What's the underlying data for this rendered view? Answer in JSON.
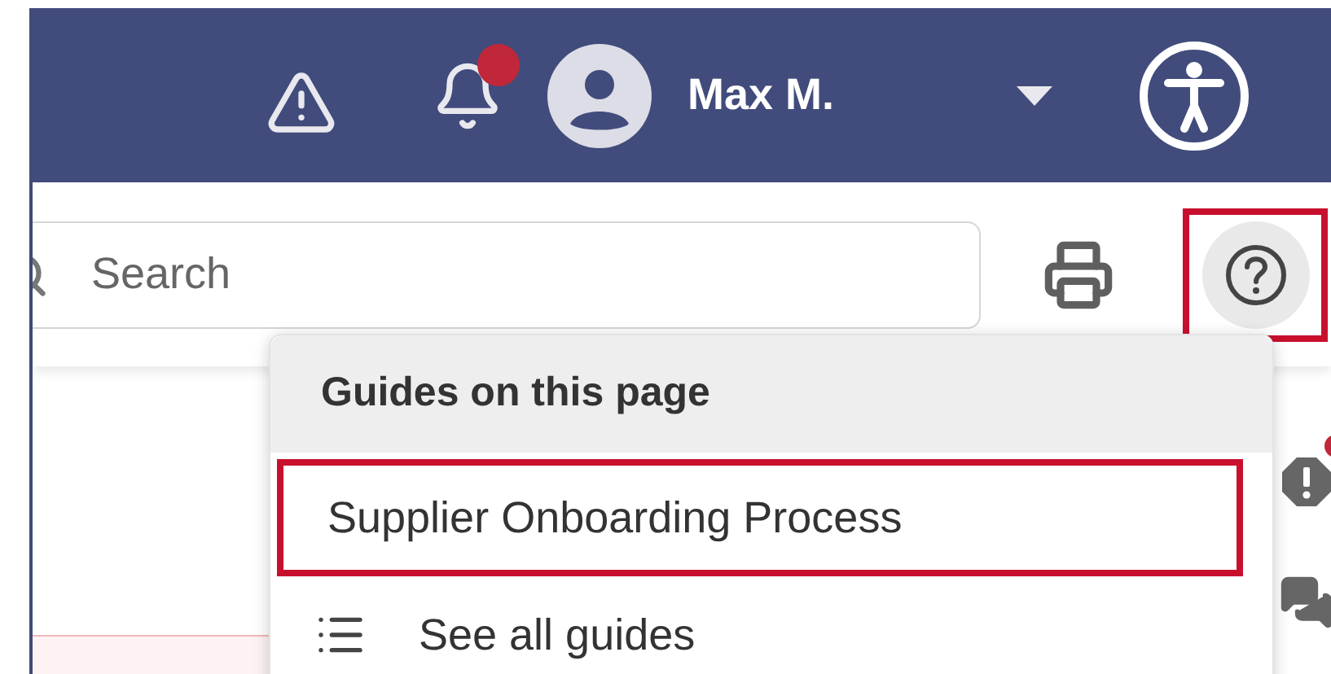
{
  "header": {
    "user_name": "Max M.",
    "notifications_unread": true
  },
  "toolbar": {
    "search": {
      "placeholder": "Search"
    },
    "help_button": {
      "highlighted": true
    }
  },
  "guides_menu": {
    "title": "Guides on this page",
    "items": [
      {
        "kind": "guide",
        "label": "Supplier Onboarding Process",
        "highlighted": true
      },
      {
        "kind": "all",
        "label": "See all guides",
        "highlighted": false
      }
    ]
  },
  "side_icons": {
    "alert_unread": true
  }
}
